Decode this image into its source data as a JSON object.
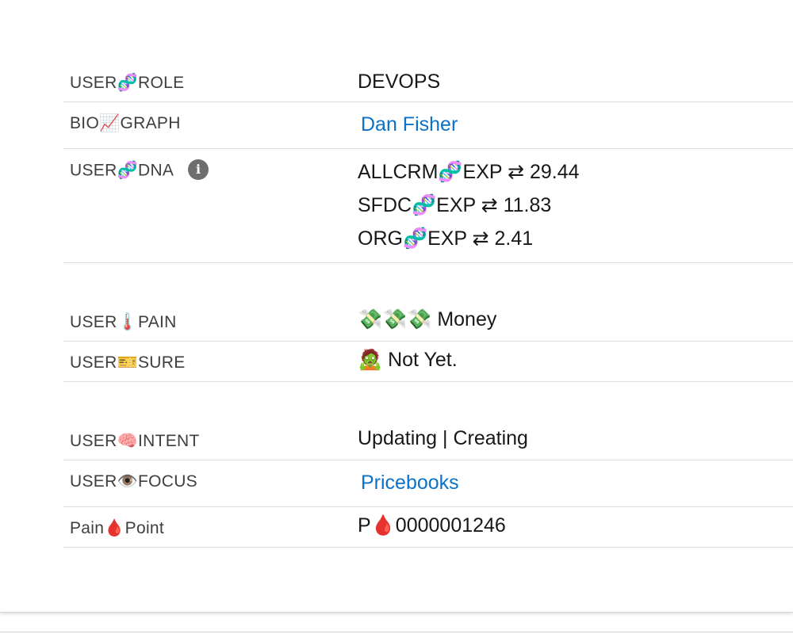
{
  "section1": {
    "rows": [
      {
        "label": "USER🧬ROLE",
        "value": "DEVOPS"
      },
      {
        "label": "BIO📈GRAPH",
        "value": "Dan Fisher"
      },
      {
        "label": "USER🧬DNA",
        "info_icon": "i",
        "values": [
          "ALLCRM🧬EXP ⇄ 29.44",
          "SFDC🧬EXP ⇄ 11.83",
          "ORG🧬EXP ⇄ 2.41"
        ]
      }
    ]
  },
  "section2": {
    "rows": [
      {
        "label": "USER🌡️PAIN",
        "value": "💸💸💸 Money"
      },
      {
        "label": "USER🎫SURE",
        "value": "🧟 Not Yet."
      }
    ]
  },
  "section3": {
    "rows": [
      {
        "label": "USER🧠INTENT",
        "value": "Updating | Creating"
      },
      {
        "label": "USER👁️FOCUS",
        "value": "Pricebooks"
      },
      {
        "label": "Pain🩸Point",
        "value": "P🩸0000001246"
      }
    ]
  },
  "colors": {
    "link": "#0b72c9",
    "label": "#3e3e3c",
    "value": "#181818",
    "divider": "#dddddd",
    "info_icon_bg": "#6e6e6e"
  }
}
